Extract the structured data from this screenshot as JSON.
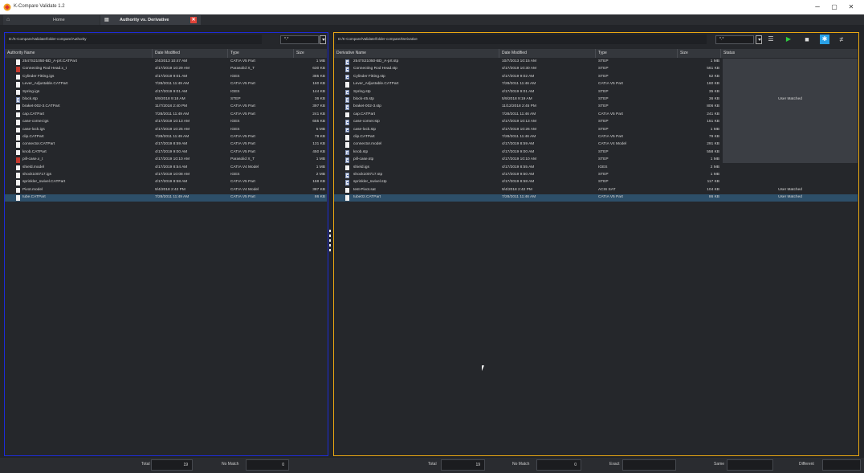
{
  "window": {
    "title": "K-Compare Validate 1.2",
    "minimize": "–",
    "maximize": "▢",
    "close": "✕"
  },
  "tabs": [
    {
      "label": "Home"
    },
    {
      "label": "Authority vs. Derivative"
    }
  ],
  "left": {
    "path": "D:/K-Compare/Validate/folder-compare/Authority",
    "filter": "*.*",
    "columns": [
      "Authority Name",
      "Date Modified",
      "Type",
      "Size"
    ],
    "rows": [
      {
        "icon": "doc",
        "name": "2547S21050-BD_A-prt.CATPart",
        "date": "2/4/2013 10:47 AM",
        "type": "CATIA V5 Part",
        "size": "1 MB"
      },
      {
        "icon": "para",
        "name": "Connecting Rod Head.x_t",
        "date": "4/17/2019 10:29 AM",
        "type": "Parasolid X_T",
        "size": "630 KB"
      },
      {
        "icon": "doc",
        "name": "Cylinder Fitting.igs",
        "date": "4/17/2019 9:01 AM",
        "type": "IGES",
        "size": "385 KB"
      },
      {
        "icon": "doc",
        "name": "Lever_Adjustable.CATPart",
        "date": "7/28/2011 11:49 AM",
        "type": "CATIA V5 Part",
        "size": "160 KB"
      },
      {
        "icon": "doc",
        "name": "Spring.igs",
        "date": "4/17/2019 9:01 AM",
        "type": "IGES",
        "size": "144 KB"
      },
      {
        "icon": "step",
        "name": "block.stp",
        "date": "5/9/2018 9:18 AM",
        "type": "STEP",
        "size": "36 KB"
      },
      {
        "icon": "doc",
        "name": "braket-002-3.CATPart",
        "date": "11/7/2018 2:40 PM",
        "type": "CATIA V5 Part",
        "size": "397 KB"
      },
      {
        "icon": "doc",
        "name": "cap.CATPart",
        "date": "7/28/2011 11:49 AM",
        "type": "CATIA V5 Part",
        "size": "241 KB"
      },
      {
        "icon": "doc",
        "name": "case-corner.igs",
        "date": "4/17/2019 10:13 AM",
        "type": "IGES",
        "size": "655 KB"
      },
      {
        "icon": "doc",
        "name": "case-lock.igs",
        "date": "4/17/2019 10:25 AM",
        "type": "IGES",
        "size": "5 MB"
      },
      {
        "icon": "doc",
        "name": "clip.CATPart",
        "date": "7/28/2011 11:49 AM",
        "type": "CATIA V5 Part",
        "size": "79 KB"
      },
      {
        "icon": "doc",
        "name": "connector.CATPart",
        "date": "4/17/2019 8:59 AM",
        "type": "CATIA V5 Part",
        "size": "131 KB"
      },
      {
        "icon": "doc",
        "name": "knob.CATPart",
        "date": "4/17/2019 9:00 AM",
        "type": "CATIA V5 Part",
        "size": "450 KB"
      },
      {
        "icon": "para",
        "name": "pill-case.x_t",
        "date": "4/17/2019 10:10 AM",
        "type": "Parasolid X_T",
        "size": "1 MB"
      },
      {
        "icon": "doc",
        "name": "shield.model",
        "date": "4/17/2019 8:54 AM",
        "type": "CATIA V4 Model",
        "size": "1 MB"
      },
      {
        "icon": "doc",
        "name": "shock100717.igs",
        "date": "4/17/2019 10:08 AM",
        "type": "IGES",
        "size": "2 MB"
      },
      {
        "icon": "doc",
        "name": "sprinkler_swivel.CATPart",
        "date": "4/17/2019 8:58 AM",
        "type": "CATIA V5 Part",
        "size": "168 KB"
      },
      {
        "icon": "doc",
        "name": "Pivot.model",
        "date": "9/4/2018 2:42 PM",
        "type": "CATIA V4 Model",
        "size": "387 KB"
      },
      {
        "icon": "doc",
        "name": "tube.CATPart",
        "date": "7/28/2011 11:49 AM",
        "type": "CATIA V5 Part",
        "size": "86 KB",
        "selected": true
      }
    ]
  },
  "right": {
    "path": "D:/K-Compare/Validate/folder-compare/Derivative",
    "filter": "*.*",
    "columns": [
      "Derivative Name",
      "Date Modified",
      "Type",
      "Size",
      "Status"
    ],
    "rows": [
      {
        "icon": "step",
        "name": "2547S21050-BD_A-prt.stp",
        "date": "10/7/2013 10:15 AM",
        "type": "STEP",
        "size": "1 MB",
        "status": ""
      },
      {
        "icon": "step",
        "name": "Connecting Rod Head.stp",
        "date": "4/17/2019 10:30 AM",
        "type": "STEP",
        "size": "561 KB",
        "status": ""
      },
      {
        "icon": "step",
        "name": "Cylinder Fitting.stp",
        "date": "4/17/2019 9:02 AM",
        "type": "STEP",
        "size": "52 KB",
        "status": ""
      },
      {
        "icon": "doc",
        "name": "Lever_Adjustable.CATPart",
        "date": "7/28/2011 11:46 AM",
        "type": "CATIA V5 Part",
        "size": "160 KB",
        "status": ""
      },
      {
        "icon": "step",
        "name": "Spring.stp",
        "date": "4/17/2019 9:01 AM",
        "type": "STEP",
        "size": "35 KB",
        "status": ""
      },
      {
        "icon": "step",
        "name": "block-45.stp",
        "date": "5/9/2018 9:19 AM",
        "type": "STEP",
        "size": "36 KB",
        "status": "User Matched"
      },
      {
        "icon": "step",
        "name": "braket-002-3.stp",
        "date": "11/12/2018 2:45 PM",
        "type": "STEP",
        "size": "806 KB",
        "status": ""
      },
      {
        "icon": "doc",
        "name": "cap.CATPart",
        "date": "7/28/2011 11:46 AM",
        "type": "CATIA V5 Part",
        "size": "241 KB",
        "status": ""
      },
      {
        "icon": "step",
        "name": "case-corner.stp",
        "date": "4/17/2019 10:13 AM",
        "type": "STEP",
        "size": "151 KB",
        "status": ""
      },
      {
        "icon": "step",
        "name": "case-lock.stp",
        "date": "4/17/2019 10:26 AM",
        "type": "STEP",
        "size": "1 MB",
        "status": ""
      },
      {
        "icon": "doc",
        "name": "clip.CATPart",
        "date": "7/28/2011 11:46 AM",
        "type": "CATIA V5 Part",
        "size": "79 KB",
        "status": ""
      },
      {
        "icon": "doc",
        "name": "connector.model",
        "date": "4/17/2019 8:59 AM",
        "type": "CATIA V4 Model",
        "size": "291 KB",
        "status": ""
      },
      {
        "icon": "step",
        "name": "knob.stp",
        "date": "4/17/2019 9:00 AM",
        "type": "STEP",
        "size": "558 KB",
        "status": ""
      },
      {
        "icon": "step",
        "name": "pill-case.stp",
        "date": "4/17/2019 10:10 AM",
        "type": "STEP",
        "size": "1 MB",
        "status": ""
      },
      {
        "icon": "doc",
        "name": "shield.igs",
        "date": "4/17/2019 8:55 AM",
        "type": "IGES",
        "size": "2 MB",
        "status": ""
      },
      {
        "icon": "step",
        "name": "shock100717.stp",
        "date": "4/17/2019 9:50 AM",
        "type": "STEP",
        "size": "1 MB",
        "status": ""
      },
      {
        "icon": "step",
        "name": "sprinkler_swivel.stp",
        "date": "4/17/2019 8:58 AM",
        "type": "STEP",
        "size": "117 KB",
        "status": ""
      },
      {
        "icon": "doc",
        "name": "test-Pivot.sat",
        "date": "9/4/2018 2:42 PM",
        "type": "ACIS SAT",
        "size": "104 KB",
        "status": "User Matched"
      },
      {
        "icon": "doc",
        "name": "tube02.CATPart",
        "date": "7/28/2011 11:46 AM",
        "type": "CATIA V5 Part",
        "size": "86 KB",
        "status": "User Matched",
        "selected": true
      }
    ]
  },
  "toolbar": {
    "list_icon": "list-icon",
    "play_icon": "play-icon",
    "stop_icon": "stop-icon",
    "settings_icon": "asterisk-icon",
    "not_equal_icon": "not-equal-icon"
  },
  "footer": {
    "left_total_label": "Total",
    "left_total": "19",
    "left_nomatch_label": "No Match",
    "left_nomatch": "0",
    "right_total_label": "Total",
    "right_total": "19",
    "right_nomatch_label": "No Match",
    "right_nomatch": "0",
    "exact_label": "Exact",
    "exact": "",
    "same_label": "Same",
    "same": "",
    "different_label": "Different",
    "different": ""
  },
  "colors": {
    "authority_border": "#1d2bd6",
    "derivative_border": "#e8a612",
    "selected_row": "#2d4f69",
    "play_green": "#2ecc40",
    "accent_blue": "#2aa1e6"
  }
}
